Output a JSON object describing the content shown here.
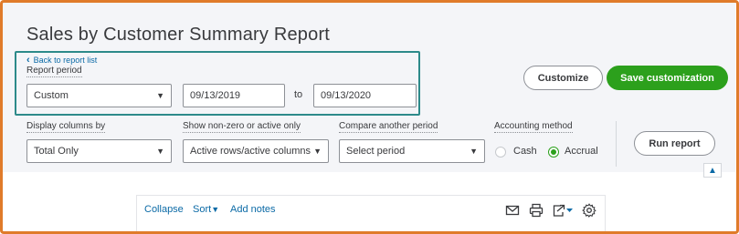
{
  "page_title": "Sales by Customer Summary Report",
  "back_link": "Back to report list",
  "report_period": {
    "label": "Report period",
    "selected": "Custom",
    "from_date": "09/13/2019",
    "to_text": "to",
    "to_date": "09/13/2020"
  },
  "buttons": {
    "customize": "Customize",
    "save_customization": "Save customization",
    "run_report": "Run report"
  },
  "display_columns": {
    "label": "Display columns by",
    "selected": "Total Only"
  },
  "show_nonzero": {
    "label": "Show non-zero or active only",
    "selected": "Active rows/active columns"
  },
  "compare_period": {
    "label": "Compare another period",
    "placeholder": "Select period"
  },
  "accounting_method": {
    "label": "Accounting method",
    "options": [
      "Cash",
      "Accrual"
    ],
    "selected": "Accrual"
  },
  "toolbar": {
    "collapse": "Collapse",
    "sort": "Sort",
    "add_notes": "Add notes"
  },
  "icons": [
    "chevron-left-icon",
    "dropdown-caret-icon",
    "chevron-up-icon",
    "email-icon",
    "print-icon",
    "export-icon",
    "gear-icon"
  ],
  "colors": {
    "accent_green": "#2ca01c",
    "link_blue": "#0b6aa6",
    "highlight_teal": "#2d8a8a",
    "frame_orange": "#e07b2a"
  }
}
